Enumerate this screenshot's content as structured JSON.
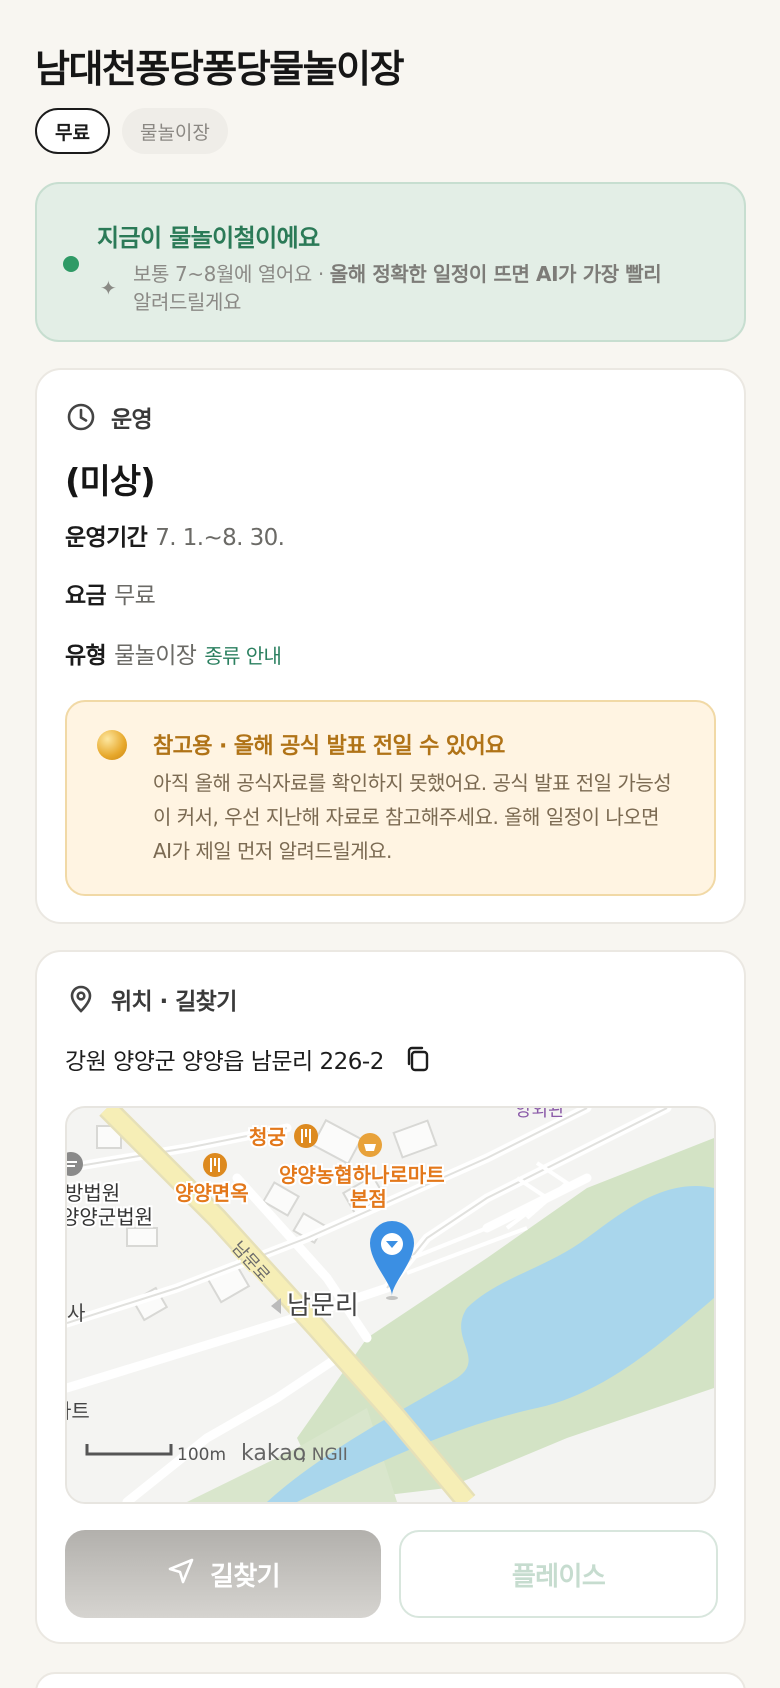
{
  "place": {
    "title": "남대천퐁당퐁당물놀이장",
    "tags": [
      "무료",
      "물놀이장"
    ]
  },
  "season": {
    "title": "지금이 물놀이철이에요",
    "desc_prefix": "보통 7~8월에 열어요 · ",
    "desc_bold": "올해 정확한 일정이 뜨면 AI가 가장 빨리",
    "desc_suffix": "알려드릴게요"
  },
  "operation": {
    "section_label": "운영",
    "status": "(미상)",
    "period_label": "운영기간",
    "period_value": "7. 1.~8. 30.",
    "fee_label": "요금",
    "fee_value": "무료",
    "type_label": "유형",
    "type_value": "물놀이장",
    "type_link": "종류 안내"
  },
  "notice": {
    "title": "참고용 · 올해 공식 발표 전일 수 있어요",
    "body": "아직 올해 공식자료를 확인하지 못했어요. 공식 발표 전일 가능성이 커서, 우선 지난해 자료로 참고해주세요. 올해 일정이 나오면 AI가 제일 먼저 알려드릴게요."
  },
  "location": {
    "section_label": "위치 · 길찾기",
    "address": "강원 양양군 양양읍 남문리 226-2"
  },
  "map": {
    "labels": {
      "cheonggung": "청궁",
      "yangyang_myeonok": "양양면옥",
      "nonghyup_line1": "양양농협하나로마트",
      "nonghyup_line2": "본점",
      "court_line1": "방법원",
      "court_line2": "양양군법원",
      "namunri": "남문리",
      "road": "남문로",
      "left_sa": "사",
      "left_mart": "마트",
      "top_right": "양외관",
      "scale": "100m",
      "brand": "kakao",
      "brand_suffix": ", NGII"
    },
    "colors": {
      "water": "#a9d6ec",
      "park": "#d3e3c5",
      "road_main": "#f6eeb6",
      "poi": "#e3781b",
      "pin": "#3b8fe3"
    }
  },
  "actions": {
    "directions": "길찾기",
    "place": "플레이스"
  },
  "icons": {
    "clock": "clock-icon",
    "pin": "location-pin-icon",
    "copy": "copy-icon",
    "sparkle": "sparkle-icon",
    "navigation": "navigation-arrow-icon"
  }
}
